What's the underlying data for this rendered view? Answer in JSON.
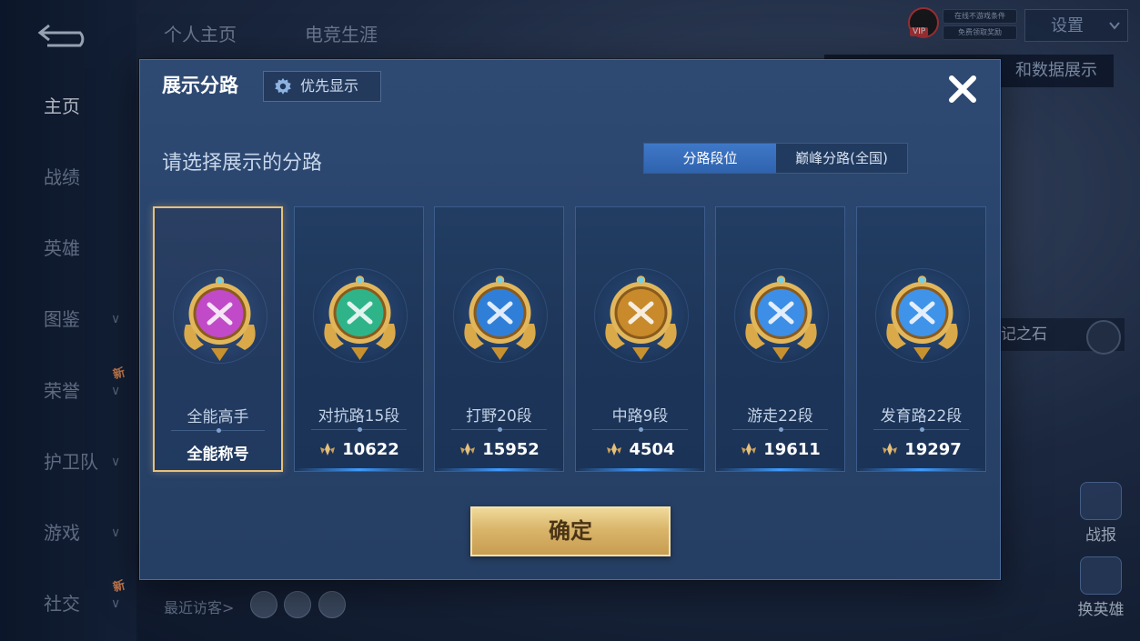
{
  "sidebar": {
    "items": [
      {
        "label": "主页",
        "active": true,
        "chevron": false,
        "badge": ""
      },
      {
        "label": "战绩",
        "active": false,
        "chevron": false,
        "badge": ""
      },
      {
        "label": "英雄",
        "active": false,
        "chevron": false,
        "badge": ""
      },
      {
        "label": "图鉴",
        "active": false,
        "chevron": true,
        "badge": ""
      },
      {
        "label": "荣誉",
        "active": false,
        "chevron": true,
        "badge": "新"
      },
      {
        "label": "护卫队",
        "active": false,
        "chevron": true,
        "badge": ""
      },
      {
        "label": "游戏",
        "active": false,
        "chevron": true,
        "badge": ""
      },
      {
        "label": "社交",
        "active": false,
        "chevron": true,
        "badge": "新"
      }
    ]
  },
  "top_tabs": [
    "个人主页",
    "电竞生涯"
  ],
  "header": {
    "settings_label": "设置",
    "vip_label": "VIP",
    "status_1": "在线不游戏条件",
    "status_2": "免费领取奖励"
  },
  "background": {
    "data_display_label": "和数据展示",
    "stone_label": "记之石",
    "report_label": "战报",
    "swap_hero_label": "换英雄",
    "visitors_label": "最近访客>"
  },
  "modal": {
    "title": "展示分路",
    "priority_label": "优先显示",
    "section_title": "请选择展示的分路",
    "tabs": [
      {
        "label": "分路段位",
        "active": true
      },
      {
        "label": "巅峰分路(全国)",
        "active": false
      }
    ],
    "cards": [
      {
        "name": "全能高手",
        "value": "全能称号",
        "selected": true,
        "badge_color": "#c14ac8"
      },
      {
        "name": "对抗路15段",
        "value": "10622",
        "selected": false,
        "badge_color": "#2fb489"
      },
      {
        "name": "打野20段",
        "value": "15952",
        "selected": false,
        "badge_color": "#2f7fd8"
      },
      {
        "name": "中路9段",
        "value": "4504",
        "selected": false,
        "badge_color": "#c88a2a"
      },
      {
        "name": "游走22段",
        "value": "19611",
        "selected": false,
        "badge_color": "#3c8ee6"
      },
      {
        "name": "发育路22段",
        "value": "19297",
        "selected": false,
        "badge_color": "#3f93e8"
      }
    ],
    "confirm_label": "确定"
  },
  "colors": {
    "accent_blue": "#3f78c8",
    "gold": "#e7c07a",
    "panel": "#2e4a73"
  }
}
